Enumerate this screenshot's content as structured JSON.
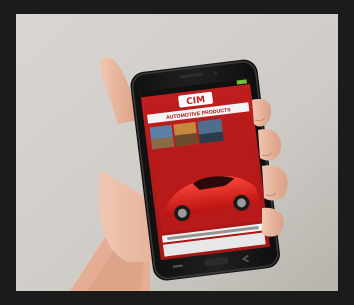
{
  "phone": {
    "screen": {
      "logo_text": "CIM",
      "banner_text": "AUTOMOTIVE PRODUCTS"
    }
  },
  "colors": {
    "frame": "#1b1b1b",
    "wall": "#cfccc8",
    "phone_body": "#151515",
    "screen_red": "#c11e1e",
    "car_red": "#d21a1a",
    "skin": "#e8b39a"
  }
}
